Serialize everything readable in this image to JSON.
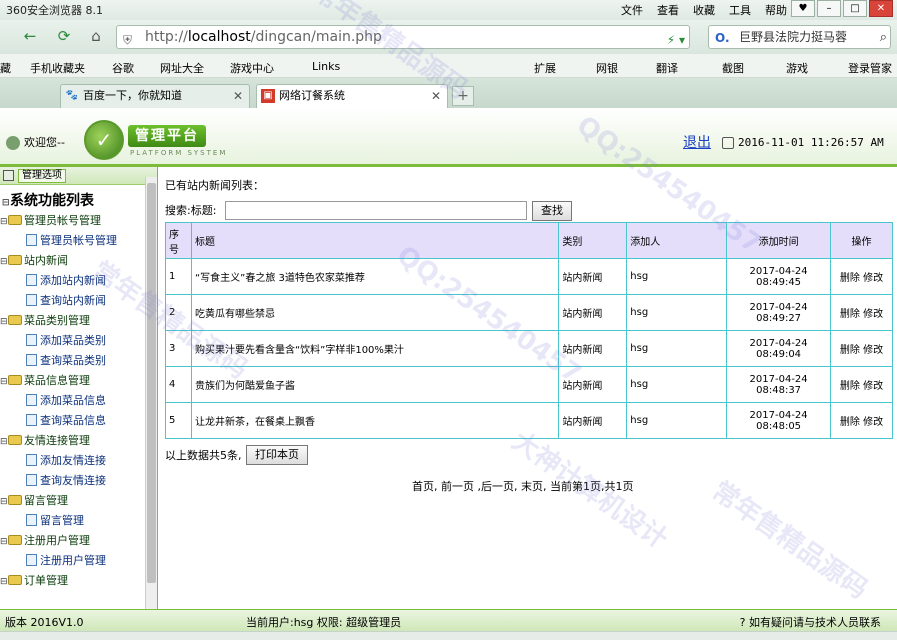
{
  "browser": {
    "title": "360安全浏览器 8.1",
    "menus": [
      "文件",
      "查看",
      "收藏",
      "工具",
      "帮助"
    ],
    "url_prefix": "http://",
    "url_host": "localhost",
    "url_path": "/dingcan/main.php",
    "search_text": "巨野县法院力挺马蓉",
    "favorites_left": [
      "藏",
      "手机收藏夹",
      "谷歌",
      "网址大全",
      "游戏中心",
      "Links"
    ],
    "favorites_right": [
      "扩展",
      "网银",
      "翻译",
      "截图",
      "游戏",
      "登录管家"
    ],
    "tabs": [
      {
        "label": "百度一下，你就知道",
        "active": false
      },
      {
        "label": "网络订餐系统",
        "active": true
      }
    ]
  },
  "header": {
    "welcome": "欢迎您--",
    "logo_text": "管理平台",
    "logo_sub": "PLATFORM SYSTEM",
    "logout": "退出",
    "datetime": "2016-11-01 11:26:57 AM"
  },
  "sidebar": {
    "tab_label": "管理选项",
    "root": "系统功能列表",
    "groups": [
      {
        "label": "管理员帐号管理",
        "items": [
          "管理员帐号管理"
        ]
      },
      {
        "label": "站内新闻",
        "items": [
          "添加站内新闻",
          "查询站内新闻"
        ]
      },
      {
        "label": "菜品类别管理",
        "items": [
          "添加菜品类别",
          "查询菜品类别"
        ]
      },
      {
        "label": "菜品信息管理",
        "items": [
          "添加菜品信息",
          "查询菜品信息"
        ]
      },
      {
        "label": "友情连接管理",
        "items": [
          "添加友情连接",
          "查询友情连接"
        ]
      },
      {
        "label": "留言管理",
        "items": [
          "留言管理"
        ]
      },
      {
        "label": "注册用户管理",
        "items": [
          "注册用户管理"
        ]
      },
      {
        "label": "订单管理",
        "items": []
      }
    ]
  },
  "main": {
    "heading": "已有站内新闻列表：",
    "search_label": "搜索:标题:",
    "search_value": "",
    "search_button": "查找",
    "columns": [
      "序号",
      "标题",
      "类别",
      "添加人",
      "添加时间",
      "操作"
    ],
    "rows": [
      {
        "no": "1",
        "title": "“写食主义”春之旅 3道特色农家菜推荐",
        "category": "站内新闻",
        "author": "hsg",
        "date": "2017-04-24",
        "time": "08:49:45"
      },
      {
        "no": "2",
        "title": "吃黄瓜有哪些禁忌",
        "category": "站内新闻",
        "author": "hsg",
        "date": "2017-04-24",
        "time": "08:49:27"
      },
      {
        "no": "3",
        "title": "购买果汁要先看含量含“饮料”字样非100%果汁",
        "category": "站内新闻",
        "author": "hsg",
        "date": "2017-04-24",
        "time": "08:49:04"
      },
      {
        "no": "4",
        "title": "贵族们为何酷爱鱼子酱",
        "category": "站内新闻",
        "author": "hsg",
        "date": "2017-04-24",
        "time": "08:48:37"
      },
      {
        "no": "5",
        "title": "让龙井新茶，在餐桌上飘香",
        "category": "站内新闻",
        "author": "hsg",
        "date": "2017-04-24",
        "time": "08:48:05"
      }
    ],
    "delete_label": "删除",
    "edit_label": "修改",
    "summary": "以上数据共5条,",
    "print_button": "打印本页",
    "pager": "首页, 前一页 ,后一页, 末页, 当前第1页,共1页"
  },
  "status": {
    "version": "版本 2016V1.0",
    "current_user": "当前用户:hsg 权限: 超级管理员",
    "help": "如有疑问请与技术人员联系"
  },
  "watermarks": [
    "常年售精品源码",
    "QQ:254540457",
    "大神计算机设计"
  ]
}
